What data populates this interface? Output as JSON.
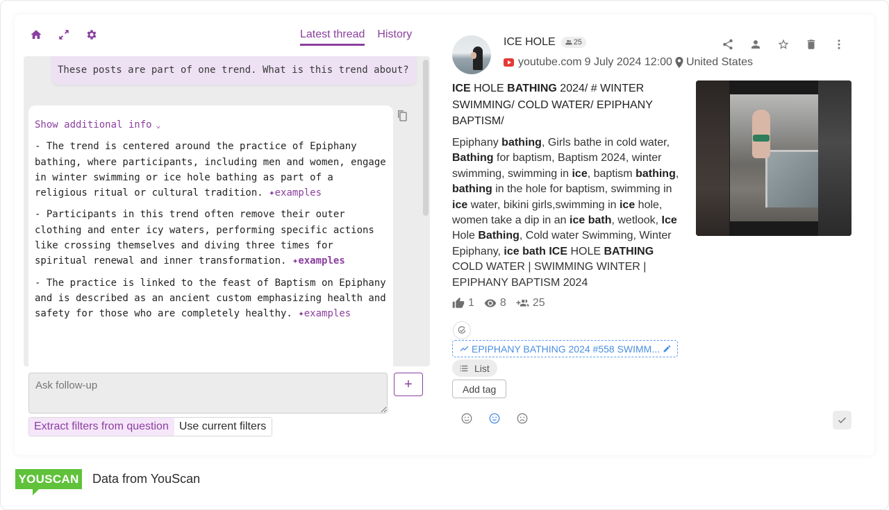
{
  "left_panel": {
    "top_icons": [
      {
        "name": "home-icon"
      },
      {
        "name": "expand-icon"
      },
      {
        "name": "settings-icon"
      }
    ],
    "tabs": [
      {
        "label": "Latest thread",
        "active": true
      },
      {
        "label": "History",
        "active": false
      }
    ],
    "question": "These posts are part of one trend. What is this trend about?",
    "answer": {
      "show_more_label": "Show additional info",
      "paragraphs": [
        {
          "text": "- The trend is centered around the practice of Epiphany bathing, where participants, including men and women, engage in winter swimming or ice hole bathing as part of a religious ritual or cultural tradition.",
          "examples_label": "examples"
        },
        {
          "text": "- Participants in this trend often remove their outer clothing and enter icy waters, performing specific actions like crossing themselves and diving three times for spiritual renewal and inner transformation.",
          "examples_label": "examples"
        },
        {
          "text": "- The practice is linked to the feast of Baptism on Epiphany and is described as an ancient custom emphasizing health and safety for those who are completely healthy.",
          "examples_label": "examples"
        }
      ]
    },
    "followup": {
      "placeholder": "Ask follow-up",
      "value": ""
    },
    "send_label": "+",
    "filter_options": [
      {
        "label": "Extract filters from question",
        "selected": true
      },
      {
        "label": "Use current filters",
        "selected": false
      }
    ]
  },
  "post": {
    "author": "ICE HOLE",
    "audience_badge": "25",
    "source": "youtube.com",
    "date": "9 July 2024 12:00",
    "location": "United States",
    "actions": [
      "share",
      "assign-user",
      "favorite",
      "delete",
      "more"
    ],
    "title_segments": [
      {
        "t": "ICE",
        "b": true
      },
      {
        "t": " HOLE ",
        "b": false
      },
      {
        "t": "BATHING",
        "b": true
      },
      {
        "t": " 2024/ # WINTER SWIMMING/ COLD WATER/ EPIPHANY BAPTISM/",
        "b": false
      }
    ],
    "body_segments": [
      {
        "t": "Epiphany ",
        "b": false
      },
      {
        "t": "bathing",
        "b": true
      },
      {
        "t": ", Girls bathe in cold water, ",
        "b": false
      },
      {
        "t": "Bathing",
        "b": true
      },
      {
        "t": " for baptism, Baptism 2024, winter swimming, swimming in ",
        "b": false
      },
      {
        "t": "ice",
        "b": true
      },
      {
        "t": ", baptism ",
        "b": false
      },
      {
        "t": "bathing",
        "b": true
      },
      {
        "t": ", ",
        "b": false
      },
      {
        "t": "bathing",
        "b": true
      },
      {
        "t": " in the hole for baptism, swimming in ",
        "b": false
      },
      {
        "t": "ice",
        "b": true
      },
      {
        "t": " water, bikini girls,swimming in ",
        "b": false
      },
      {
        "t": "ice",
        "b": true
      },
      {
        "t": " hole, women take a dip in an ",
        "b": false
      },
      {
        "t": "ice bath",
        "b": true
      },
      {
        "t": ", wetlook, ",
        "b": false
      },
      {
        "t": "Ice",
        "b": true
      },
      {
        "t": " Hole ",
        "b": false
      },
      {
        "t": "Bathing",
        "b": true
      },
      {
        "t": ", Cold water Swimming, Winter Epiphany, ",
        "b": false
      },
      {
        "t": "ice bath ICE",
        "b": true
      },
      {
        "t": " HOLE ",
        "b": false
      },
      {
        "t": "BATHING",
        "b": true
      },
      {
        "t": " COLD WATER | SWIMMING WINTER | EPIPHANY BAPTISM 2024",
        "b": false
      }
    ],
    "stats": {
      "likes": "1",
      "views": "8",
      "audience": "25"
    },
    "trend_tag": "EPIPHANY BATHING 2024 #558 SWIMM...",
    "list_label": "List",
    "add_tag_label": "Add tag",
    "sentiment": {
      "options": [
        "positive",
        "neutral",
        "negative"
      ],
      "selected": "neutral"
    },
    "colors": {
      "accent": "#8a3f9e",
      "trend": "#4a8fe0",
      "youtube": "#e53935"
    }
  },
  "footer": {
    "logo": "YOUSCAN",
    "text": "Data from YouScan"
  }
}
